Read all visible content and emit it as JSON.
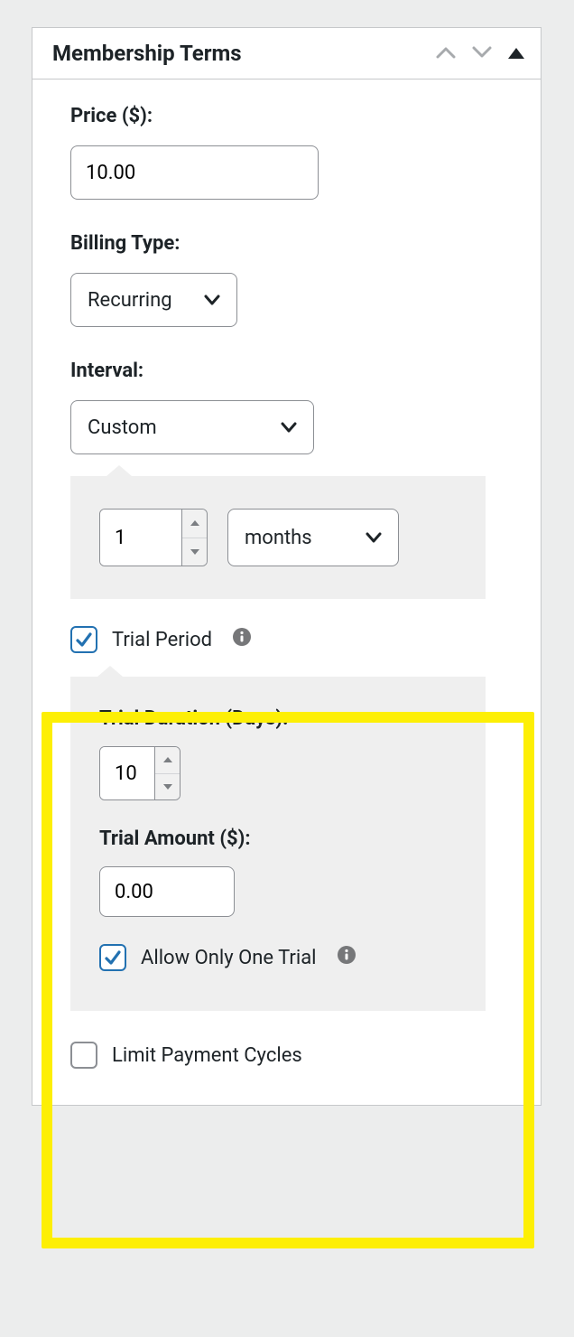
{
  "panel": {
    "title": "Membership Terms"
  },
  "price": {
    "label": "Price ($):",
    "value": "10.00"
  },
  "billing_type": {
    "label": "Billing Type:",
    "value": "Recurring"
  },
  "interval": {
    "label": "Interval:",
    "value": "Custom",
    "count": "1",
    "unit": "months"
  },
  "trial": {
    "label": "Trial Period",
    "checked": true,
    "duration_label": "Trial Duration (Days):",
    "duration_value": "10",
    "amount_label": "Trial Amount ($):",
    "amount_value": "0.00",
    "allow_one_label": "Allow Only One Trial",
    "allow_one_checked": true
  },
  "limit": {
    "label": "Limit Payment Cycles",
    "checked": false
  }
}
